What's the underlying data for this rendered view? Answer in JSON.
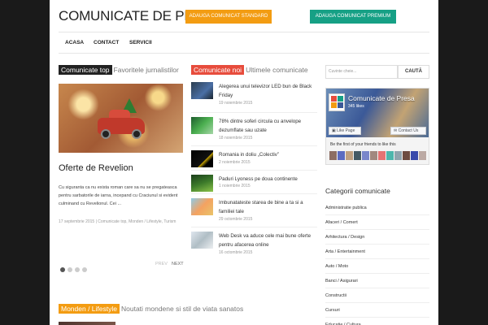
{
  "header": {
    "site_title": "COMUNICATE DE PRESA",
    "btn_standard": "ADAUGA COMUNICAT STANDARD",
    "btn_premium": "ADAUGA COMUNICAT PREMIUM"
  },
  "nav": [
    "ACASA",
    "CONTACT",
    "SERVICII"
  ],
  "featured": {
    "tag": "Comunicate top",
    "subtitle": "Favoritele jurnalistilor",
    "post_title": "Oferte de Revelion",
    "excerpt": "Cu siguranta ca nu exista roman care sa nu se pregateasca pentru sarbatorile de iarna, incepand cu Craciunul si evident culminand cu Revelionul. Cei ...",
    "meta": "17 septembrie 2015 | Comunicate top, Monden / Lifestyle, Turism",
    "prev": "PREV",
    "next": "NEXT"
  },
  "news": {
    "tag": "Comunicate noi",
    "subtitle": "Ultimele comunicate",
    "items": [
      {
        "title": "Alegerea unui televizor LED bun de Black Friday",
        "date": "19 noiembrie 2015"
      },
      {
        "title": "78% dintre soferi circula cu anvelope dezumflate sau uzate",
        "date": "18 noiembrie 2015"
      },
      {
        "title": "Romania in doliu „Colectiv”",
        "date": "2 noiembrie 2015"
      },
      {
        "title": "Paduri Lyoness pe doua continente",
        "date": "1 noiembrie 2015"
      },
      {
        "title": "Imbunatateste starea de bine a ta si a familiei tale",
        "date": "29 octombrie 2015"
      },
      {
        "title": "Web Desk va aduce cele mai bune oferte pentru afacerea online",
        "date": "16 octombrie 2015"
      }
    ]
  },
  "sidebar": {
    "search_placeholder": "Cuvinte cheie...",
    "search_button": "CAUTĂ",
    "fb_page_name": "Comunicate de Presa",
    "fb_likes": "345 likes",
    "fb_like_label": "Like Page",
    "fb_contact_label": "Contact Us",
    "fb_friends_text": "Be the first of your friends to like this",
    "categories_title": "Categorii comunicate",
    "categories": [
      "Administratie publica",
      "Afaceri / Comert",
      "Arhitectura / Design",
      "Arta / Entertainment",
      "Auto / Moto",
      "Banci / Asigurari",
      "Constructii",
      "Cursuri",
      "Educatie / Cultura"
    ]
  },
  "bottom": {
    "tag": "Monden / Lifestyle",
    "subtitle": "Noutati mondene si stil de viata sanatos"
  },
  "colors": {
    "featured_tag": "#222222",
    "news_tag": "#e74c3c",
    "bottom_tag": "#f39c12",
    "btn_standard": "#f39c12",
    "btn_premium": "#16a085"
  }
}
